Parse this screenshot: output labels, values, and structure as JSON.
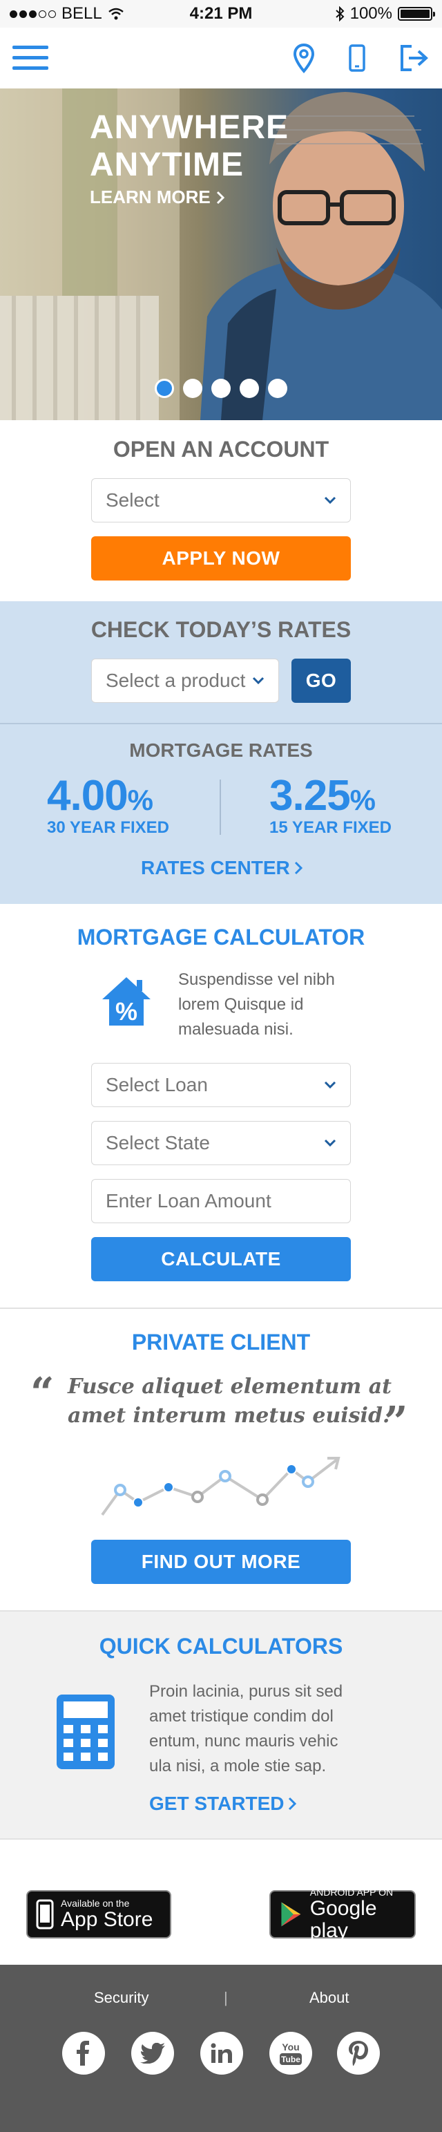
{
  "status_bar": {
    "carrier": "BELL",
    "time": "4:21 PM",
    "battery": "100%"
  },
  "navbar": {
    "menu_icon": "menu-icon",
    "location_icon": "location-pin-icon",
    "phone_icon": "mobile-phone-icon",
    "signin_icon": "sign-in-icon"
  },
  "hero": {
    "title_line1": "ANYWHERE",
    "title_line2": "ANYTIME",
    "link": "LEARN MORE",
    "slides": 5,
    "active_slide": 1
  },
  "open_account": {
    "title": "OPEN AN ACCOUNT",
    "select_value": "Select",
    "button": "APPLY NOW"
  },
  "check_rates": {
    "title": "CHECK TODAY’S RATES",
    "select_value": "Select a product",
    "button": "GO"
  },
  "mortgage_rates": {
    "title": "MORTGAGE RATES",
    "rates": [
      {
        "value": "4.00",
        "unit": "%",
        "label": "30 YEAR FIXED"
      },
      {
        "value": "3.25",
        "unit": "%",
        "label": "15 YEAR FIXED"
      }
    ],
    "link": "RATES CENTER"
  },
  "mortgage_calculator": {
    "title": "MORTGAGE CALCULATOR",
    "icon": "house-percent-icon",
    "text_lines": [
      "Suspendisse vel nibh",
      "lorem Quisque id",
      "malesuada nisi."
    ],
    "select_loan": "Select Loan",
    "select_state": "Select State",
    "loan_amount_placeholder": "Enter Loan Amount",
    "button": "CALCULATE"
  },
  "private_client": {
    "title": "PRIVATE CLIENT",
    "quote_line1": "Fusce aliquet elementum at",
    "quote_line2": "amet interum metus euisid.",
    "open_quote": "“",
    "close_quote": "”",
    "button": "FIND OUT MORE"
  },
  "quick_calculators": {
    "title": "QUICK CALCULATORS",
    "icon": "calculator-icon",
    "text_lines": [
      "Proin lacinia, purus sit sed",
      "amet tristique condim dol",
      "entum, nunc mauris vehic",
      "ula nisi, a mole stie sap."
    ],
    "link": "GET STARTED"
  },
  "app_badges": {
    "apple_small": "Available on the",
    "apple_big": "App Store",
    "google_small": "ANDROID APP ON",
    "google_big": "Google play"
  },
  "footer": {
    "links": [
      "Security",
      "About"
    ],
    "separator": "|",
    "social": [
      "facebook-icon",
      "twitter-icon",
      "linkedin-icon",
      "youtube-icon",
      "pinterest-icon"
    ],
    "youtube_label_top": "You",
    "youtube_label_bottom": "Tube"
  },
  "colors": {
    "accent": "#2b8ae6",
    "orange": "#ff7c04",
    "navy": "#1e5d9e",
    "rates_bg": "#cfe0f1",
    "footer_bg": "#595959"
  }
}
